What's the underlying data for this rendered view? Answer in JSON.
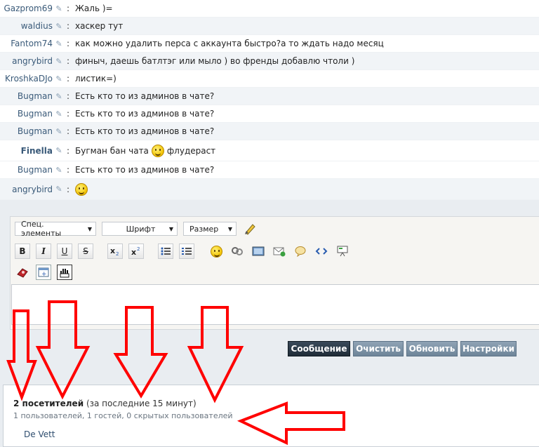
{
  "chat": {
    "messages": [
      {
        "nick": "Gazprom69",
        "text": "Жаль )="
      },
      {
        "nick": "waldius",
        "text": "хаскер тут"
      },
      {
        "nick": "Fantom74",
        "text": "как можно удалить перса с аккаунта быстро?а то ждать надо месяц"
      },
      {
        "nick": "angrybird",
        "text": "финыч, даешь батлтэг или мыло ) во френды добавлю чтоли )"
      },
      {
        "nick": "KroshkaDJo",
        "text": "листик=)"
      },
      {
        "nick": "Bugman",
        "text": "Есть кто то из админов в чате?"
      },
      {
        "nick": "Bugman",
        "text": "Есть кто то из админов в чате?"
      },
      {
        "nick": "Bugman",
        "text": "Есть кто то из админов в чате?"
      },
      {
        "nick": "Finella",
        "text_before": "Бугман бан чата",
        "text_after": "флудераст",
        "icon": "smiley-icon"
      },
      {
        "nick": "Bugman",
        "text": "Есть кто то из админов в чате?"
      },
      {
        "nick": "angrybird",
        "icon": "smiley-icon"
      }
    ],
    "separator": ":"
  },
  "editor": {
    "special_elements": "Спец. элементы",
    "font": "Шрифт",
    "size": "Размер",
    "bold": "B",
    "italic": "I",
    "underline": "U",
    "strike": "S"
  },
  "buttons": {
    "message": "Сообщение",
    "clear": "Очистить",
    "refresh": "Обновить",
    "settings": "Настройки"
  },
  "visitors": {
    "count": "2 посетителей",
    "period": "(за последние 15 минут)",
    "breakdown": "1 пользователей, 1 гостей, 0 скрытых пользователей",
    "user": "De Vett"
  },
  "colors": {
    "nick": "#3a5a79",
    "annotation_arrow": "#ff0000",
    "primary_button": "#1f2c38",
    "secondary_button": "#7d93a7"
  }
}
